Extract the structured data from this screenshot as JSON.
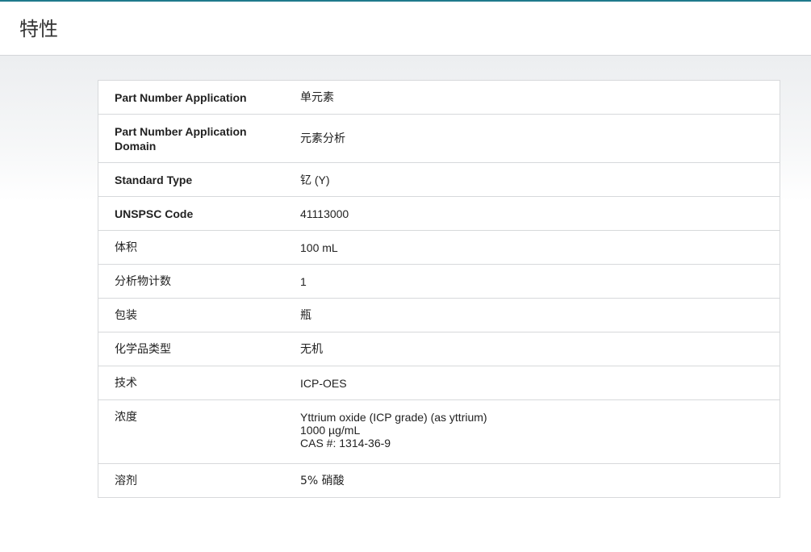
{
  "header": {
    "title": "特性"
  },
  "properties": [
    {
      "key": "Part Number Application",
      "value": "单元素"
    },
    {
      "key_lines": [
        "Part Number Application",
        "Domain"
      ],
      "value": "元素分析"
    },
    {
      "key": "Standard Type",
      "value": "钇 (Y)"
    },
    {
      "key": "UNSPSC Code",
      "value": "41113000"
    },
    {
      "key": "体积",
      "value": "100 mL"
    },
    {
      "key": "分析物计数",
      "value": "1"
    },
    {
      "key": "包装",
      "value": "瓶"
    },
    {
      "key": "化学品类型",
      "value": "无机"
    },
    {
      "key": "技术",
      "value": "ICP-OES"
    },
    {
      "key": "浓度",
      "value_lines": [
        "Yttrium oxide (ICP grade) (as yttrium)",
        "1000 µg/mL",
        "CAS #: 1314-36-9"
      ]
    },
    {
      "key": "溶剂",
      "value": "5% 硝酸"
    }
  ]
}
